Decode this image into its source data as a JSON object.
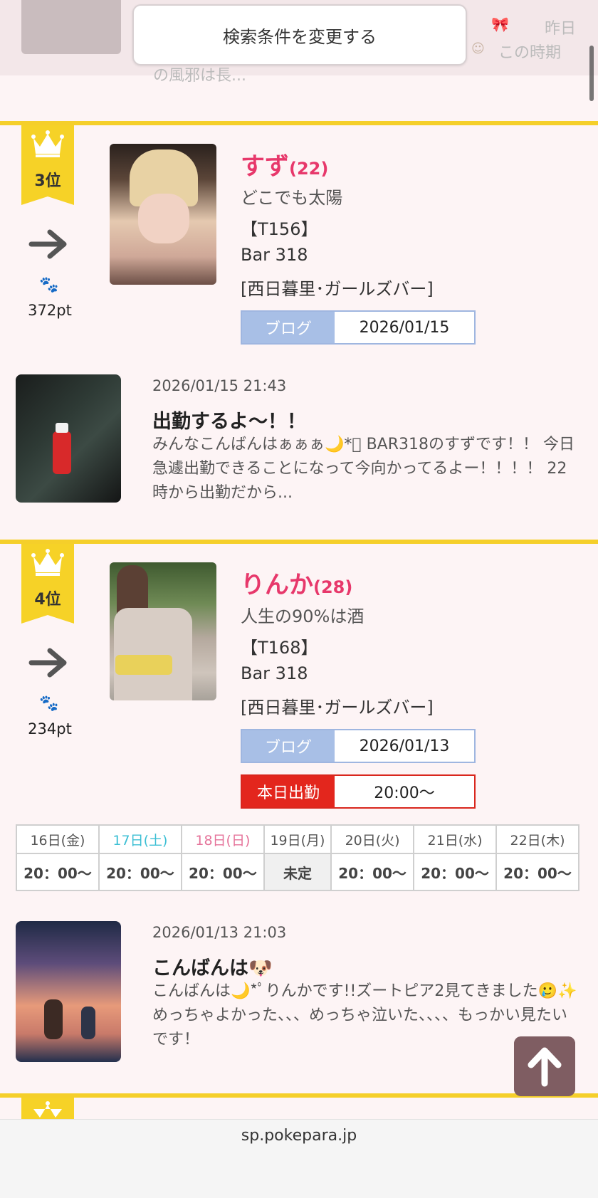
{
  "top": {
    "search_button": "検索条件を変更する",
    "faded_right_1": "昨日",
    "faded_right_2": "この時期",
    "faded_snippet": "の風邪は長..."
  },
  "rankings": [
    {
      "rank": "3位",
      "trend_icon": "arrow-right-icon",
      "points": "372pt",
      "name": "すず",
      "age": "(22)",
      "catchphrase": "どこでも太陽",
      "height": "【T156】",
      "shop": "Bar 318",
      "area": "[西日暮里･ガールズバー]",
      "blog_label": "ブログ",
      "blog_date": "2026/01/15",
      "blog_post": {
        "datetime": "2026/01/15 21:43",
        "title": "出勤するよ〜！！",
        "body": "みんなこんばんはぁぁぁ🌙*ﾟ BAR318のすずです！！ 今日急遽出勤できることになって今向かってるよー！！！！ 22時から出勤だから..."
      }
    },
    {
      "rank": "4位",
      "trend_icon": "arrow-right-icon",
      "points": "234pt",
      "name": "りんか",
      "age": "(28)",
      "catchphrase": "人生の90%は酒",
      "height": "【T168】",
      "shop": "Bar 318",
      "area": "[西日暮里･ガールズバー]",
      "blog_label": "ブログ",
      "blog_date": "2026/01/13",
      "work_label": "本日出勤",
      "work_time": "20:00〜",
      "schedule": {
        "days": [
          "16日(金)",
          "17日(土)",
          "18日(日)",
          "19日(月)",
          "20日(火)",
          "21日(水)",
          "22日(木)"
        ],
        "times": [
          "20：00〜",
          "20：00〜",
          "20：00〜",
          "未定",
          "20：00〜",
          "20：00〜",
          "20：00〜"
        ]
      },
      "blog_post": {
        "datetime": "2026/01/13 21:03",
        "title": "こんばんは🐶",
        "body": "こんばんは🌙*ﾟりんかです!!ズートピア2見てきました🥲✨めっちゃよかった、、、めっちゃ泣いた、、、、もっかい見たいです！"
      }
    }
  ],
  "colors": {
    "accent_pink": "#e7386b",
    "rank_yellow": "#f6d227",
    "blog_blue": "#a8bfe6",
    "work_red": "#e3261d",
    "saturday": "#3cbfd4",
    "sunday": "#e5739a"
  },
  "browser": {
    "url": "sp.pokepara.jp"
  }
}
